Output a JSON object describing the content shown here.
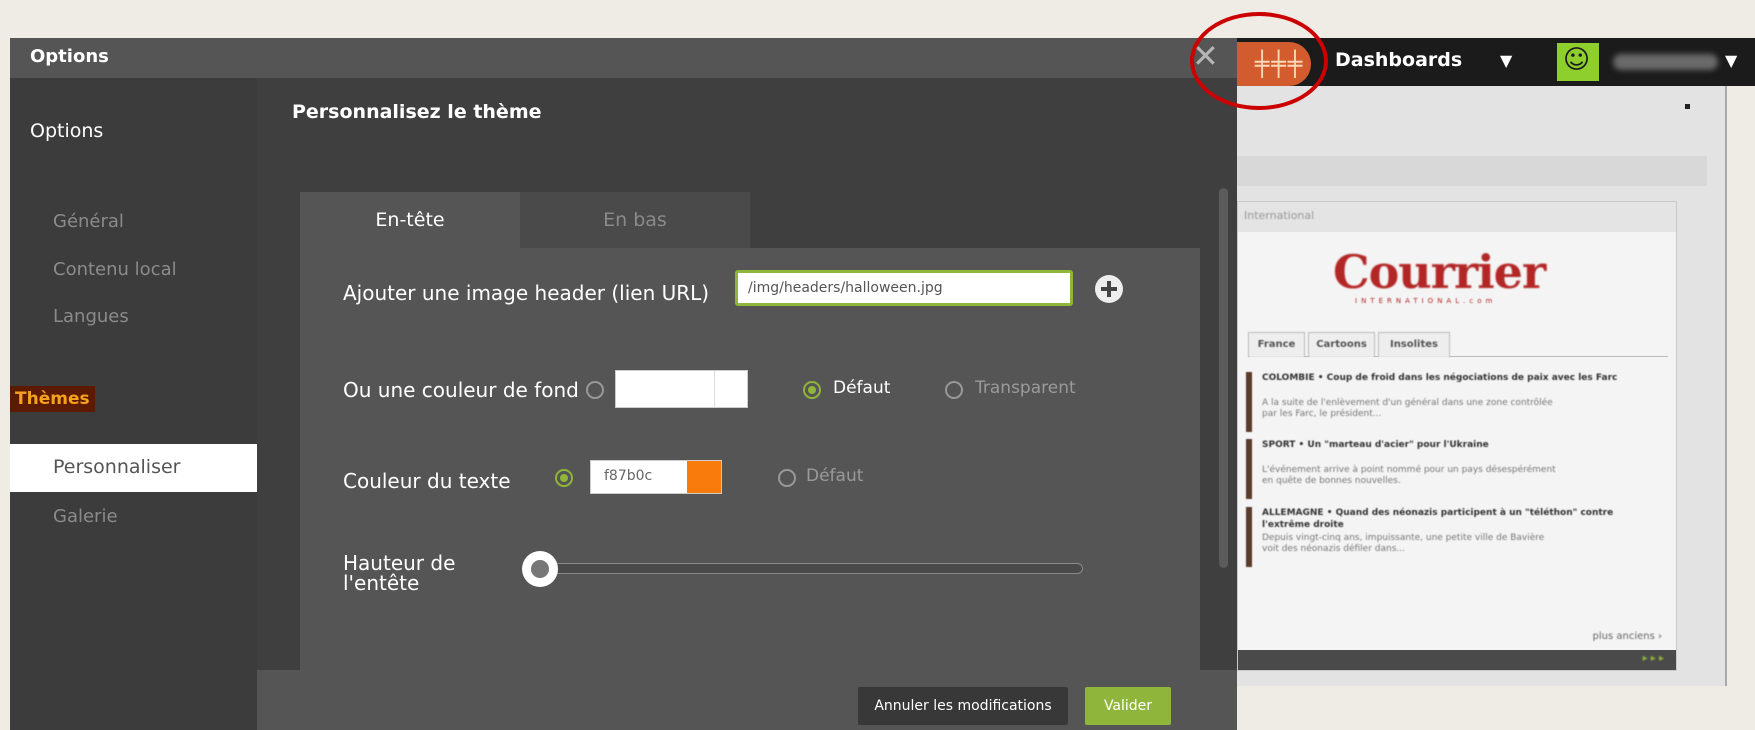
{
  "modal": {
    "title": "Options",
    "close_icon": "close-icon",
    "sidebar": {
      "heading": "Options",
      "items": [
        {
          "label": "Général"
        },
        {
          "label": "Contenu local"
        },
        {
          "label": "Langues"
        },
        {
          "label": "Thèmes"
        },
        {
          "label": "Personnaliser"
        },
        {
          "label": "Galerie"
        }
      ]
    },
    "panel": {
      "title": "Personnalisez le thème",
      "tabs": [
        {
          "label": "En-tête",
          "active": true
        },
        {
          "label": "En bas",
          "active": false
        }
      ],
      "header_image": {
        "label": "Ajouter une image header (lien URL)",
        "value": "/img/headers/halloween.jpg",
        "add_icon": "plus-circle-icon"
      },
      "background_color": {
        "label": "Ou une couleur de fond",
        "custom_selected": false,
        "option_default": "Défaut",
        "default_selected": true,
        "option_transparent": "Transparent",
        "transparent_selected": false
      },
      "text_color": {
        "label": "Couleur du texte",
        "custom_selected": true,
        "value": "f87b0c",
        "swatch": "#f87b0c",
        "option_default": "Défaut",
        "default_selected": false
      },
      "header_height": {
        "label": "Hauteur de l'entête",
        "value": 0
      }
    },
    "footer": {
      "cancel_label": "Annuler les modifications",
      "validate_label": "Valider"
    }
  },
  "topbar": {
    "app_icon": "equalizer-icon",
    "dashboards_label": "Dashboards",
    "dashboards_caret": "▼",
    "avatar_icon": "smiley-avatar-icon",
    "user_caret": "▼"
  },
  "background_widget": {
    "title": "International",
    "logo_text": "Courrier",
    "logo_sub": "INTERNATIONAL.com",
    "tabs": [
      "France",
      "Cartoons",
      "Insolites"
    ],
    "news": [
      {
        "title": "COLOMBIE • Coup de froid dans les négociations de paix avec les Farc",
        "body": "A la suite de l'enlèvement d'un général dans une zone contrôlée par les Farc, le président..."
      },
      {
        "title": "SPORT • Un \"marteau d'acier\" pour l'Ukraine",
        "body": "L'événement arrive à point nommé pour un pays désespérément en quête de bonnes nouvelles."
      },
      {
        "title": "ALLEMAGNE • Quand des néonazis participent à un \"téléthon\" contre l'extrême droite",
        "body": "Depuis vingt-cinq ans, impuissante, une petite ville de Bavière voit des néonazis défiler dans..."
      }
    ],
    "more_label": "plus anciens ›"
  },
  "colors": {
    "accent_green": "#8fb63a",
    "brand_orange": "#d35c2e",
    "text_color_swatch": "#f87b0c",
    "highlight_circle": "#cc0000",
    "themes_badge_bg": "#5c1a00",
    "themes_badge_text": "#f7a21c"
  }
}
